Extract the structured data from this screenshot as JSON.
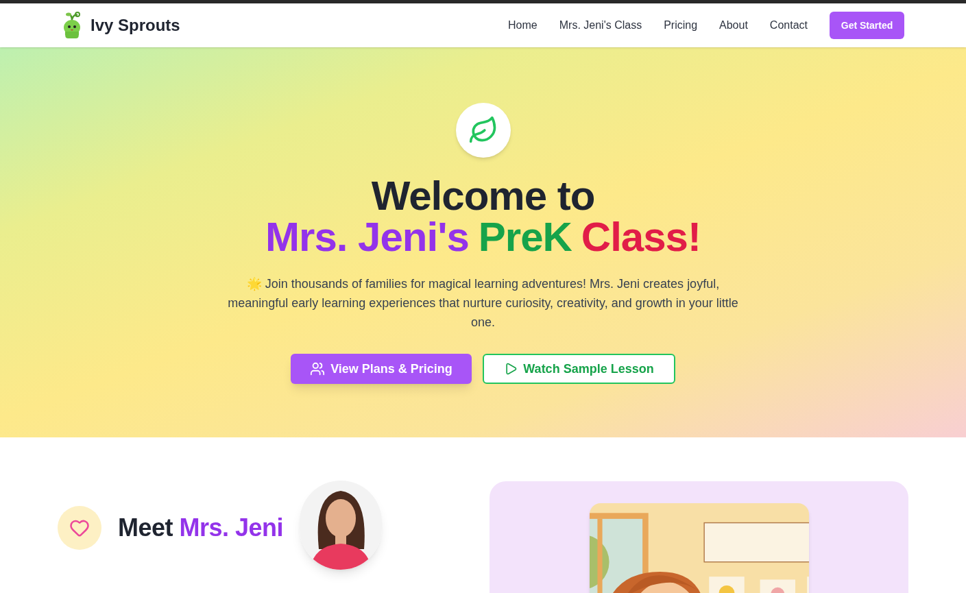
{
  "brand": {
    "name": "Ivy Sprouts"
  },
  "nav": {
    "items": [
      {
        "label": "Home"
      },
      {
        "label": "Mrs. Jeni's Class"
      },
      {
        "label": "Pricing"
      },
      {
        "label": "About"
      },
      {
        "label": "Contact"
      }
    ],
    "cta": "Get Started"
  },
  "hero": {
    "title_line_1": "Welcome to",
    "title_line_2": [
      {
        "text": "Mrs. Jeni's",
        "color": "#9333ea"
      },
      {
        "text": "PreK",
        "color": "#16a34a"
      },
      {
        "text": "Class!",
        "color": "#e11d48"
      }
    ],
    "intro": "🌟 Join thousands of families for magical learning adventures! Mrs. Jeni creates joyful, meaningful early learning experiences that nurture curiosity, creativity, and growth in your little one.",
    "buttons": [
      {
        "kind": "primary",
        "label": "View Plans & Pricing"
      },
      {
        "kind": "outline",
        "label": "Watch Sample Lesson"
      }
    ]
  },
  "meet": {
    "heading": "Meet",
    "heading_highlight": "Mrs. Jeni"
  }
}
